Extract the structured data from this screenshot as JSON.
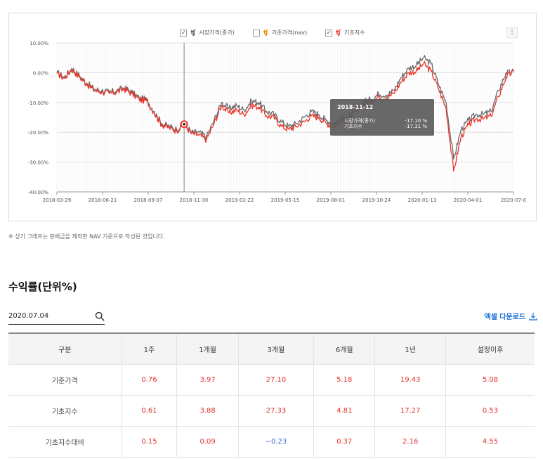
{
  "chart": {
    "legend": [
      {
        "label": "시장가격(종가)",
        "checked": true,
        "color": "#555555"
      },
      {
        "label": "기준가격(nav)",
        "checked": false,
        "color": "#f08c00"
      },
      {
        "label": "기초지수",
        "checked": true,
        "color": "#e8362b"
      }
    ],
    "menu_icon": "more-vertical-icon",
    "tooltip": {
      "date": "2018-11-12",
      "rows": [
        {
          "label": "시장가격(종가)",
          "value": "-17.10  %"
        },
        {
          "label": "기초지수",
          "value": "-17.31  %"
        }
      ]
    }
  },
  "chart_data": {
    "type": "line",
    "ylim": [
      -40,
      10
    ],
    "yticks": [
      "10.00%",
      "0.00%",
      "-10.00%",
      "-20.00%",
      "-30.00%",
      "-40.00%"
    ],
    "xticks": [
      "2018-03-29",
      "2018-06-21",
      "2018-09-07",
      "2018-11-30",
      "2019-02-22",
      "2019-05-15",
      "2019-08-01",
      "2019-10-24",
      "2020-01-13",
      "2020-04-01",
      "2020-07-0"
    ],
    "x": [
      "2018-03-29",
      "2018-04-12",
      "2018-04-26",
      "2018-05-10",
      "2018-05-24",
      "2018-06-07",
      "2018-06-21",
      "2018-07-05",
      "2018-07-19",
      "2018-08-02",
      "2018-08-16",
      "2018-08-30",
      "2018-09-07",
      "2018-09-20",
      "2018-10-04",
      "2018-10-18",
      "2018-11-01",
      "2018-11-12",
      "2018-11-30",
      "2018-12-14",
      "2018-12-28",
      "2019-01-11",
      "2019-01-25",
      "2019-02-08",
      "2019-02-22",
      "2019-03-08",
      "2019-03-22",
      "2019-04-05",
      "2019-04-19",
      "2019-05-03",
      "2019-05-15",
      "2019-05-31",
      "2019-06-14",
      "2019-06-28",
      "2019-07-12",
      "2019-07-26",
      "2019-08-01",
      "2019-08-15",
      "2019-08-29",
      "2019-09-12",
      "2019-09-26",
      "2019-10-10",
      "2019-10-24",
      "2019-11-07",
      "2019-11-21",
      "2019-12-05",
      "2019-12-19",
      "2020-01-02",
      "2020-01-13",
      "2020-01-27",
      "2020-02-10",
      "2020-02-24",
      "2020-03-09",
      "2020-03-19",
      "2020-04-01",
      "2020-04-15",
      "2020-04-29",
      "2020-05-13",
      "2020-05-27",
      "2020-06-10",
      "2020-06-24",
      "2020-07-03"
    ],
    "series": [
      {
        "name": "시장가격(종가)",
        "color": "#6b6b6b",
        "values": [
          0,
          -1.5,
          1.5,
          -1,
          -3.5,
          -5.5,
          -6,
          -6.5,
          -6,
          -5,
          -6.5,
          -8.5,
          -9,
          -13,
          -17,
          -18,
          -19,
          -17.1,
          -20,
          -20,
          -21.5,
          -16,
          -10,
          -12,
          -11,
          -12.5,
          -9.5,
          -10,
          -13,
          -14,
          -16.5,
          -18,
          -17,
          -15,
          -13,
          -14,
          -16,
          -17,
          -15.5,
          -15,
          -12,
          -9.5,
          -9,
          -7,
          -7.5,
          -6,
          -1.5,
          1.5,
          2.5,
          5,
          3,
          -4,
          -10,
          -29,
          -19,
          -16,
          -14,
          -14,
          -13,
          -6,
          0,
          0
        ]
      },
      {
        "name": "기초지수",
        "color": "#e8362b",
        "values": [
          -0.3,
          -1.9,
          1.1,
          -1.4,
          -3.9,
          -6,
          -6.5,
          -7,
          -6.5,
          -5.5,
          -7,
          -9,
          -9.5,
          -13.5,
          -17.5,
          -18.5,
          -19.5,
          -17.31,
          -20.5,
          -21,
          -22.5,
          -17,
          -11,
          -13.5,
          -12.5,
          -14,
          -11,
          -11.5,
          -14.5,
          -15,
          -18,
          -19,
          -18,
          -16.5,
          -14.5,
          -15,
          -17,
          -18,
          -16.5,
          -16,
          -13,
          -10.5,
          -10,
          -8,
          -8.5,
          -7,
          -3,
          0,
          0.5,
          3,
          0.5,
          -5.5,
          -12,
          -33,
          -21.5,
          -17.5,
          -15.5,
          -15.5,
          -14.5,
          -8,
          -1.5,
          0.5
        ]
      }
    ]
  },
  "note": "※ 상기 그래프는 분배금을 제외한 NAV 기준으로 작성된 것입니다.",
  "returns": {
    "title": "수익률(단위%)",
    "date_value": "2020.07.04",
    "excel_label": "엑셀 다운로드",
    "columns": [
      "구분",
      "1주",
      "1개월",
      "3개월",
      "6개월",
      "1년",
      "설정이후"
    ],
    "rows": [
      {
        "label": "기준가격",
        "values": [
          "0.76",
          "3.97",
          "27.10",
          "5.18",
          "19.43",
          "5.08"
        ]
      },
      {
        "label": "기초지수",
        "values": [
          "0.61",
          "3.88",
          "27.33",
          "4.81",
          "17.27",
          "0.53"
        ]
      },
      {
        "label": "기초지수대비",
        "values": [
          "0.15",
          "0.09",
          "−0.23",
          "0.37",
          "2.16",
          "4.55"
        ]
      }
    ]
  }
}
